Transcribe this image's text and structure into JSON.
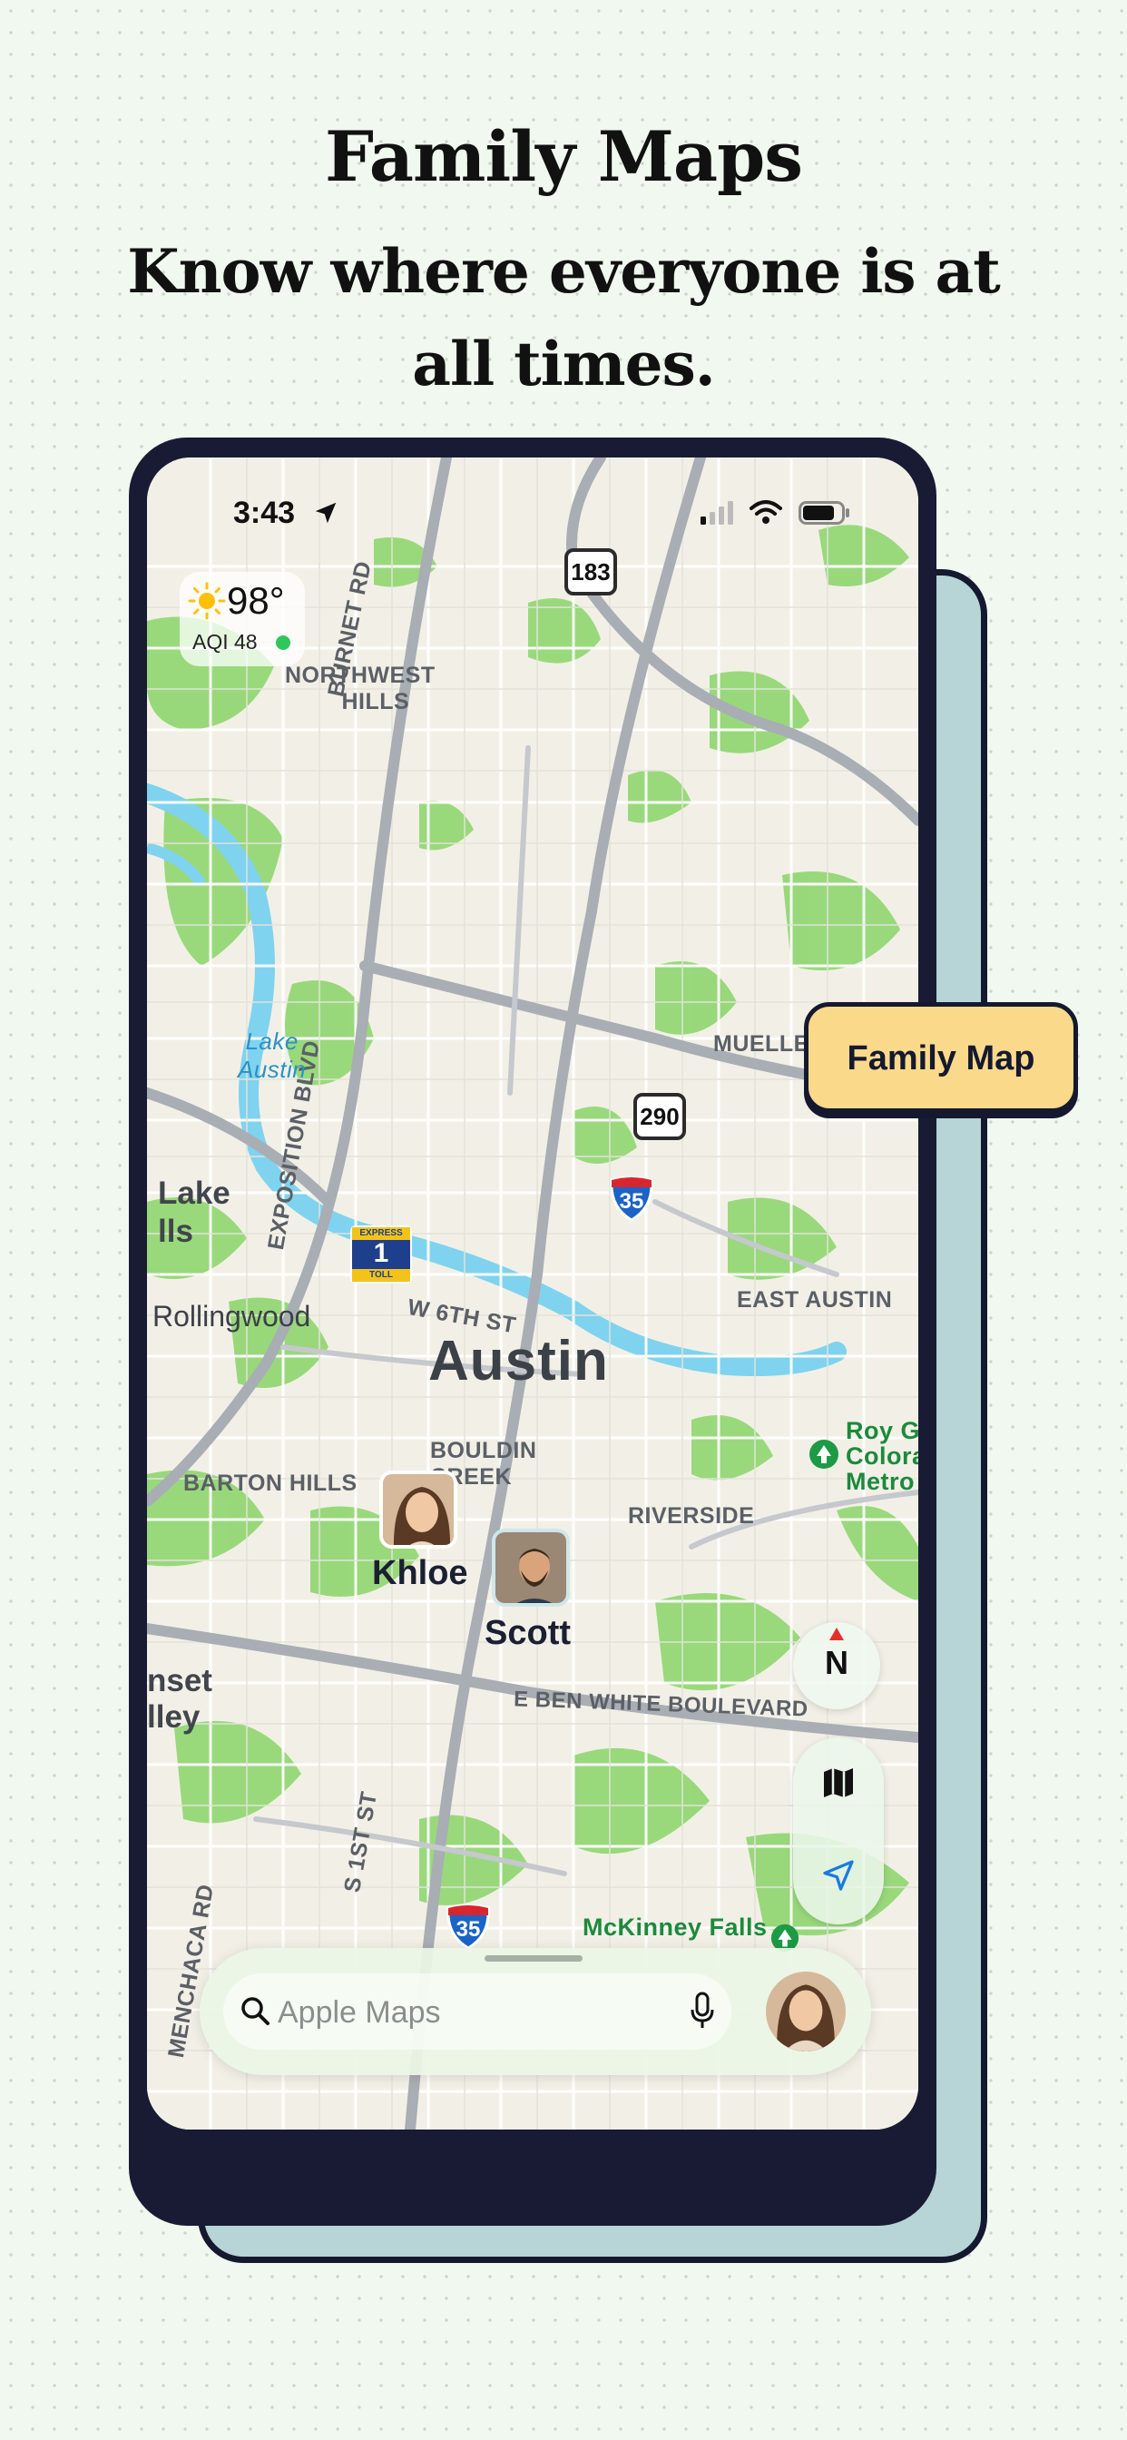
{
  "headline": {
    "title": "Family Maps",
    "subtitle": "Know where everyone is at all times."
  },
  "status_bar": {
    "time": "3:43",
    "icons": [
      "location-arrow-icon",
      "cellular-signal-icon",
      "wifi-icon",
      "battery-icon"
    ]
  },
  "weather": {
    "temperature": "98°",
    "aqi": "AQI 48",
    "icon": "sun-icon",
    "aqi_status_color": "#2fc75b"
  },
  "map": {
    "city": "Austin",
    "neighborhoods": {
      "northwest_hills_1": "NORTHWEST",
      "northwest_hills_2": "HILLS",
      "burnet_rd": "BURNET RD",
      "mueller": "MUELLE",
      "exposition_blvd": "EXPOSITION BLVD",
      "west_6th": "W 6TH ST",
      "east_austin": "EAST AUSTIN",
      "bouldin_1": "BOULDIN",
      "bouldin_2": "CREEK",
      "barton_hills": "BARTON HILLS",
      "riverside": "RIVERSIDE",
      "ben_white": "E BEN WHITE BOULEVARD",
      "s_1st": "S 1ST ST",
      "menchaca": "MENCHACA RD"
    },
    "places": {
      "lake_austin_1": "Lake",
      "lake_austin_2": "Austin",
      "west_lake_1": "Lake",
      "west_lake_2": "lls",
      "rollingwood": "Rollingwood",
      "sunset_1": "nset",
      "sunset_2": "lley",
      "roy_g_1": "Roy G",
      "roy_g_2": "Colora",
      "roy_g_3": "Metro",
      "mckinney": "McKinney Falls"
    },
    "shields": {
      "us183": "183",
      "us290": "290",
      "i35_north": "35",
      "i35_south": "35",
      "toll_express": "EXPRESS",
      "toll_number": "1",
      "toll_label": "TOLL"
    },
    "colors": {
      "land": "#f2f0e6",
      "park": "#8fd66f",
      "water": "#7fd3ef",
      "road": "#ffffff",
      "highway": "#a9adb4"
    }
  },
  "people": [
    {
      "name": "Khloe",
      "icon": "khloe-avatar"
    },
    {
      "name": "Scott",
      "icon": "scott-avatar"
    }
  ],
  "controls": {
    "compass_label": "N",
    "map_mode_icon": "map-icon",
    "locate_icon": "location-arrow-icon"
  },
  "search": {
    "placeholder": "Apple Maps",
    "search_icon": "search-icon",
    "mic_icon": "microphone-icon"
  },
  "feature_tag": {
    "label": "Family Map",
    "color": "#fbd98b"
  }
}
